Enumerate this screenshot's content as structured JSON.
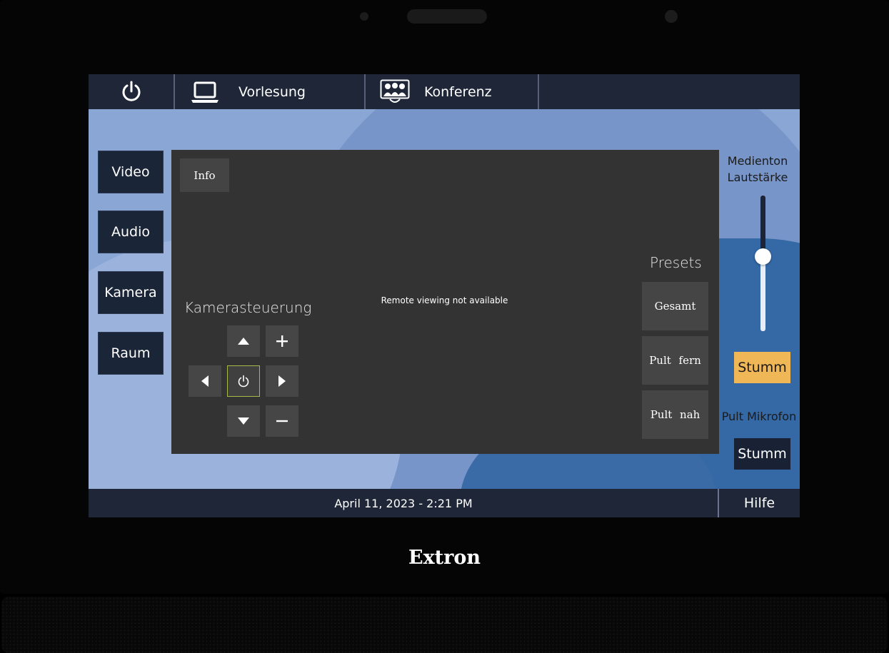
{
  "device": {
    "brand": "Extron"
  },
  "topbar": {
    "power_icon": "power-icon",
    "tabs": [
      {
        "label": "Vorlesung",
        "icon": "laptop-icon"
      },
      {
        "label": "Konferenz",
        "icon": "conference-icon"
      }
    ]
  },
  "nav": {
    "items": [
      {
        "label": "Video"
      },
      {
        "label": "Audio"
      },
      {
        "label": "Kamera",
        "active": true
      },
      {
        "label": "Raum"
      }
    ]
  },
  "camera": {
    "info_label": "Info",
    "remote_message": "Remote viewing not available",
    "control_title": "Kamerasteuerung",
    "presets_title": "Presets",
    "presets": [
      {
        "label": "Gesamt"
      },
      {
        "label": "Pult fern"
      },
      {
        "label": "Pult nah"
      }
    ]
  },
  "audio": {
    "media_title_line1": "Medienton",
    "media_title_line2": "Lautstärke",
    "media_volume_fraction": 0.55,
    "media_mute_label": "Stumm",
    "mic_title": "Pult Mikrofon",
    "mic_mute_label": "Stumm"
  },
  "footer": {
    "datetime": "April 11, 2023 - 2:21 PM",
    "help_label": "Hilfe"
  },
  "colors": {
    "bar": "#1e2638",
    "panel": "#333333",
    "mute_active": "#f0b757",
    "home_outline": "#a9b84a"
  }
}
